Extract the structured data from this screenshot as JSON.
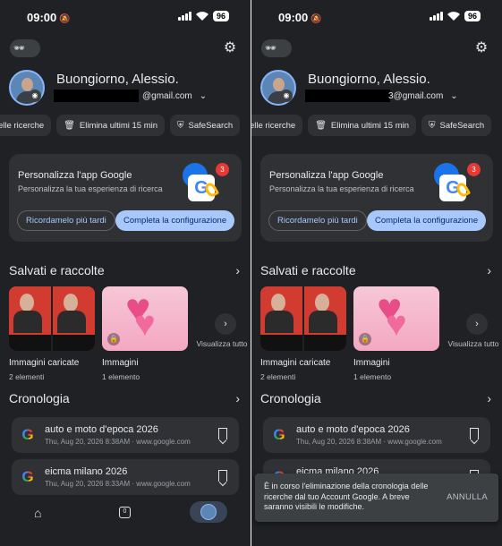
{
  "status": {
    "time": "09:00",
    "battery": "96"
  },
  "account": {
    "greeting": "Buongiorno, Alessio.",
    "email_suffix_left": "@gmail.com",
    "email_suffix_right": "3@gmail.com"
  },
  "chips": [
    {
      "label": "elle ricerche",
      "icon": "history-icon"
    },
    {
      "label": "Elimina ultimi 15 min",
      "icon": "delete-timer-icon"
    },
    {
      "label": "SafeSearch",
      "icon": "shield-icon"
    }
  ],
  "card": {
    "title": "Personalizza l'app Google",
    "subtitle": "Personalizza la tua esperienza di ricerca",
    "badge_count": "3",
    "later_label": "Ricordamelo più tardi",
    "complete_label": "Completa la configurazione"
  },
  "saved": {
    "title": "Salvati e raccolte",
    "collections": [
      {
        "name": "Immagini caricate",
        "count": "2 elementi"
      },
      {
        "name": "Immagini",
        "count": "1 elemento"
      }
    ],
    "view_all": "Visualizza tutto"
  },
  "history": {
    "title": "Cronologia",
    "items": [
      {
        "query": "auto e moto d'epoca 2026",
        "meta": "Thu, Aug 20, 2026 8:38AM · www.google.com"
      },
      {
        "query": "eicma milano 2026",
        "meta": "Thu, Aug 20, 2026 8:33AM · www.google.com"
      }
    ]
  },
  "nav": {
    "tabs_count": "0"
  },
  "snackbar": {
    "message": "È in corso l'eliminazione della cronologia delle ricerche dal tuo Account Google. A breve saranno visibili le modifiche.",
    "action": "ANNULLA"
  },
  "colors": {
    "background": "#202124",
    "surface": "#303134",
    "accent": "#a8c7fa",
    "badge": "#e53935"
  }
}
